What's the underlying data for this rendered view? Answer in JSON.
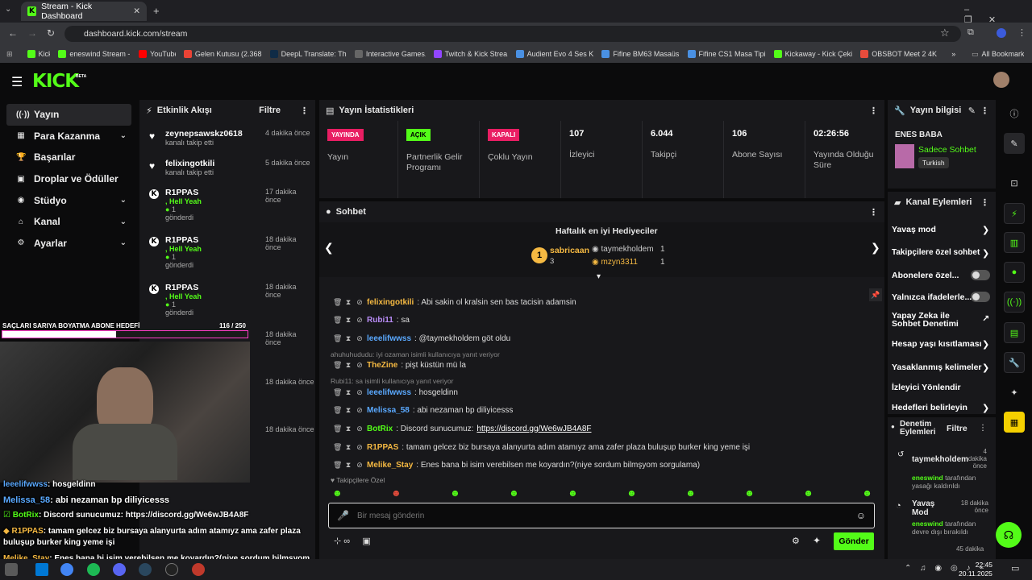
{
  "browser": {
    "tab_title": "Stream - Kick Dashboard",
    "url": "dashboard.kick.com/stream",
    "bookmarks": [
      "Kick",
      "eneswind Stream -...",
      "YouTube",
      "Gelen Kutusu (2.368...",
      "DeepL Translate: Th...",
      "Interactive Games...",
      "Twitch & Kick Strea...",
      "Audient Evo 4 Ses K...",
      "Fifine BM63 Masaüs...",
      "Fifine CS1 Masa Tipi...",
      "Kickaway - Kick Çeki...",
      "OBSBOT Meet 2 4K..."
    ],
    "all_bookmarks": "All Bookmarks"
  },
  "brand": {
    "logo": "KICK",
    "beta": "BETA",
    "accent": "#53fc18"
  },
  "sidebar": {
    "items": [
      {
        "label": "Yayın",
        "icon": "broadcast-icon",
        "active": true
      },
      {
        "label": "Para Kazanma",
        "icon": "money-icon",
        "chevron": true
      },
      {
        "label": "Başarılar",
        "icon": "trophy-icon"
      },
      {
        "label": "Droplar ve Ödüller",
        "icon": "gift-icon"
      },
      {
        "label": "Stüdyo",
        "icon": "studio-icon",
        "chevron": true
      },
      {
        "label": "Kanal",
        "icon": "channel-icon",
        "chevron": true
      },
      {
        "label": "Ayarlar",
        "icon": "gear-icon",
        "chevron": true
      }
    ]
  },
  "events": {
    "title": "Etkinlik Akışı",
    "filter": "Filtre",
    "items": [
      {
        "user": "zeynepsawskz0618",
        "time": "4 dakika önce",
        "text": "kanalı takip etti"
      },
      {
        "user": "felixingotkili",
        "time": "5 dakika önce",
        "text": "kanalı takip etti"
      },
      {
        "user": "R1PPAS",
        "time": "17 dakika önce",
        "msg": ", Hell Yeah",
        "count": "1",
        "text": "gönderdi"
      },
      {
        "user": "R1PPAS",
        "time": "18 dakika önce",
        "msg": ", Hell Yeah",
        "count": "1",
        "text": "gönderdi"
      },
      {
        "user": "R1PPAS",
        "time": "18 dakika önce",
        "msg": ", Hell Yeah",
        "count": "1",
        "text": "gönderdi"
      },
      {
        "user": "R1PPAS",
        "time": "18 dakika önce"
      }
    ],
    "extra_times": [
      "18 dakika önce",
      "18 dakika önce"
    ]
  },
  "stats": {
    "title": "Yayın İstatistikleri",
    "cards": [
      {
        "badge": "YAYINDA",
        "badge_color": "#e91e63",
        "label": "Yayın"
      },
      {
        "badge": "AÇIK",
        "badge_color": "#53fc18",
        "label": "Partnerlik Gelir Programı"
      },
      {
        "badge": "KAPALI",
        "badge_color": "#e91e63",
        "label": "Çoklu Yayın"
      },
      {
        "value": "107",
        "label": "İzleyici"
      },
      {
        "value": "6.044",
        "label": "Takipçi"
      },
      {
        "value": "106",
        "label": "Abone Sayısı"
      },
      {
        "value": "02:26:56",
        "label": "Yayında Olduğu Süre"
      }
    ]
  },
  "chat": {
    "title": "Sohbet",
    "gifters_title": "Haftalık en iyi Hediyeciler",
    "gifters": [
      {
        "rank": "1",
        "name": "sabricaan",
        "count": "3"
      },
      {
        "name": "taymekholdem",
        "count": "1"
      },
      {
        "name": "mzyn3311",
        "count": "1"
      }
    ],
    "messages": [
      {
        "user": "felixingotkili",
        "color": "#f5b942",
        "text": ": Abi sakin ol kralsin sen bas tacisin adamsin"
      },
      {
        "user": "Rubi11",
        "color": "#b98cf7",
        "text": ": sa"
      },
      {
        "user": "leeelifwwss",
        "color": "#5aa9ff",
        "text": ": @taymekholdem göt oldu"
      },
      {
        "reply": "ahuhuhududu: iyi ozaman isimli kullanıcıya yanıt veriyor"
      },
      {
        "user": "TheZine",
        "color": "#f5b942",
        "text": ": pişt küstün mü la"
      },
      {
        "reply": "Rubi11: sa isimli kullanıcıya yanıt veriyor"
      },
      {
        "user": "leeelifwwss",
        "color": "#5aa9ff",
        "text": ": hosgeldinn"
      },
      {
        "user": "Melissa_58",
        "color": "#5aa9ff",
        "text": ": abi nezaman bp diliyicesss"
      },
      {
        "user": "BotRix",
        "color": "#53fc18",
        "text": ": Discord sunucumuz: ",
        "link": "https://discord.gg/We6wJB4A8F"
      },
      {
        "user": "R1PPAS",
        "color": "#f5b942",
        "text": ": tamam gelcez biz bursaya alanyurta adım atamıyz ama zafer plaza buluşup burker king yeme işi"
      },
      {
        "user": "Melike_Stay",
        "color": "#f5b942",
        "text": ": Enes bana bi isim verebilsen me koyardın?(niye sordum bilmşyom sorgulama)"
      }
    ],
    "emote_label": "Takipçilere Özel",
    "input_placeholder": "Bir mesaj gönderin",
    "send": "Gönder"
  },
  "stream_info": {
    "title": "Yayın bilgisi",
    "streamer": "ENES BABA",
    "category": "Sadece Sohbet",
    "tag": "Turkish"
  },
  "channel_actions": {
    "title": "Kanal Eylemleri",
    "items": [
      "Yavaş mod",
      "Takipçilere özel sohbet",
      "Abonelere özel...",
      "Yalnızca ifadelerle...",
      "Yapay Zeka ile Sohbet Denetimi",
      "Hesap yaşı kısıtlaması",
      "Yasaklanmış kelimeler",
      "İzleyici Yönlendir",
      "Hedefleri belirleyin"
    ]
  },
  "mod_actions": {
    "title": "Denetim Eylemleri",
    "filter": "Filtre",
    "items": [
      {
        "user": "taymekholdem",
        "time": "4 dakika önce",
        "by": "eneswind",
        "text": "tarafından yasağı kaldırıldı"
      },
      {
        "user": "Yavaş Mod",
        "time": "18 dakika önce",
        "by": "eneswind",
        "text": "tarafından devre dışı bırakıldı"
      },
      {
        "time": "45 dakika"
      }
    ]
  },
  "overlay": {
    "goal_title": "SAÇLARI SARIYA BOYATMA ABONE HEDEFİ",
    "goal_current": "116",
    "goal_total": "250",
    "goal_fraction": 0.464,
    "lines": [
      {
        "user": "leeelifwwss",
        "text": ": hosgeldinn"
      },
      {
        "user": "Melissa_58",
        "text": ": abi nezaman bp diliyicesss"
      },
      {
        "user": "BotRix",
        "text": ": Discord sunucumuz: https://discord.gg/We6wJB4A8F"
      },
      {
        "user": "R1PPAS",
        "text": ": tamam gelcez biz bursaya alanyurta adım atamıyz ama zafer plaza buluşup burker king yeme işi"
      },
      {
        "user": "Melike_Stay",
        "text": ": Enes bana bi isim verebilsen me koyardın?(niye sordum bilmşyom sorgulama)"
      }
    ]
  },
  "taskbar": {
    "time": "22:45",
    "date": "20.11.2025"
  }
}
